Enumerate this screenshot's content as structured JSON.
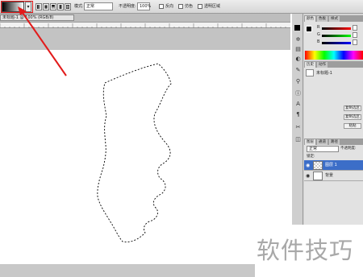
{
  "options_bar": {
    "mode_label": "模式:",
    "mode_value": "正常",
    "opacity_label": "不透明度:",
    "opacity_value": "100%",
    "reverse_label": "反向",
    "dither_label": "仿色",
    "transparency_label": "透明区域"
  },
  "document": {
    "tab_title": "未标题-1 @ 100% (RGB/8)"
  },
  "color_panel": {
    "tabs": [
      "颜色",
      "色板",
      "样式"
    ],
    "channels": [
      "R",
      "G",
      "B"
    ],
    "values": [
      "0",
      "0",
      "0"
    ]
  },
  "history_panel": {
    "tabs": [
      "历史",
      "动作"
    ],
    "item": "未标题-1"
  },
  "adjust_panel": {
    "buttons": [
      "复制选区",
      "复制选区",
      "粘贴"
    ]
  },
  "layers_panel": {
    "tabs": [
      "图层",
      "通道",
      "路径"
    ],
    "blend_mode": "正常",
    "opacity_label": "不透明度:",
    "lock_label": "锁定:",
    "layers": [
      {
        "name": "图层 1",
        "selected": true
      },
      {
        "name": "背景",
        "selected": false
      }
    ]
  },
  "watermark": "软件技巧",
  "colors": {
    "annotation": "#e21b1b",
    "selection_bg": "#3c6ec8"
  }
}
